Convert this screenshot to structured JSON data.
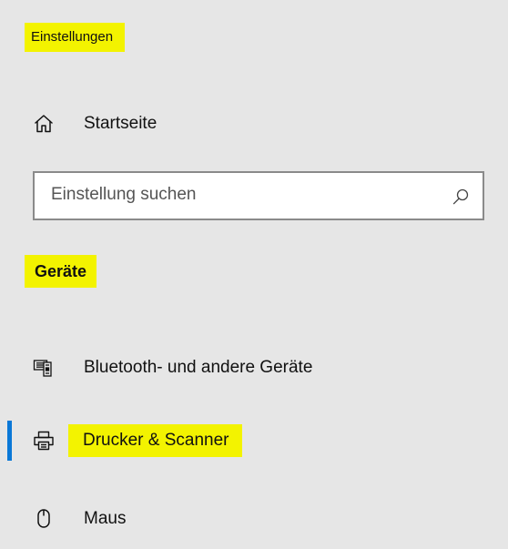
{
  "window": {
    "title": "Einstellungen"
  },
  "nav": {
    "home_label": "Startseite",
    "home_icon": "home-icon"
  },
  "search": {
    "placeholder": "Einstellung suchen",
    "icon": "search-icon"
  },
  "section": {
    "title": "Geräte"
  },
  "items": [
    {
      "label": "Bluetooth- und andere Geräte",
      "icon": "bluetooth-devices-icon",
      "active": false
    },
    {
      "label": "Drucker & Scanner",
      "icon": "printer-icon",
      "active": true
    },
    {
      "label": "Maus",
      "icon": "mouse-icon",
      "active": false
    }
  ],
  "colors": {
    "background": "#e6e6e6",
    "highlight": "#f3f300",
    "accent": "#0a78d7",
    "search_border": "#8a8a8a"
  }
}
